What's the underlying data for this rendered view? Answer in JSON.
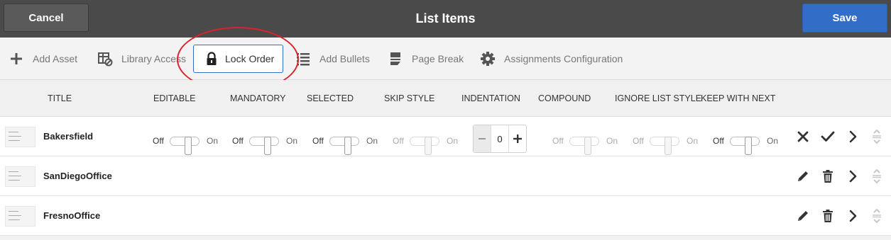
{
  "topbar": {
    "title": "List Items",
    "cancel_label": "Cancel",
    "save_label": "Save"
  },
  "toolbar": {
    "add_asset": "Add Asset",
    "library_access": "Library Access",
    "lock_order": "Lock Order",
    "add_bullets": "Add Bullets",
    "page_break": "Page Break",
    "assignments_configuration": "Assignments Configuration"
  },
  "columns": {
    "title": "TITLE",
    "editable": "EDITABLE",
    "mandatory": "MANDATORY",
    "selected": "SELECTED",
    "skip_style": "SKIP STYLE",
    "indentation": "INDENTATION",
    "compound": "COMPOUND",
    "ignore_list_style": "IGNORE LIST STYLE",
    "keep_with_next": "KEEP WITH NEXT"
  },
  "toggle_labels": {
    "off": "Off",
    "on": "On"
  },
  "rows": [
    {
      "title": "Bakersfield",
      "indentation": "0"
    },
    {
      "title": "SanDiegoOffice"
    },
    {
      "title": "FresnoOffice"
    }
  ],
  "colors": {
    "accent": "#326ec8",
    "topbar": "#4a4a4a",
    "highlight": "#d9232a"
  },
  "icons": [
    "plus-icon",
    "library-icon",
    "lock-icon",
    "bullets-icon",
    "page-break-icon",
    "gear-icon",
    "close-icon",
    "check-icon",
    "chevron-right-icon",
    "reorder-icon",
    "pencil-icon",
    "trash-icon"
  ]
}
